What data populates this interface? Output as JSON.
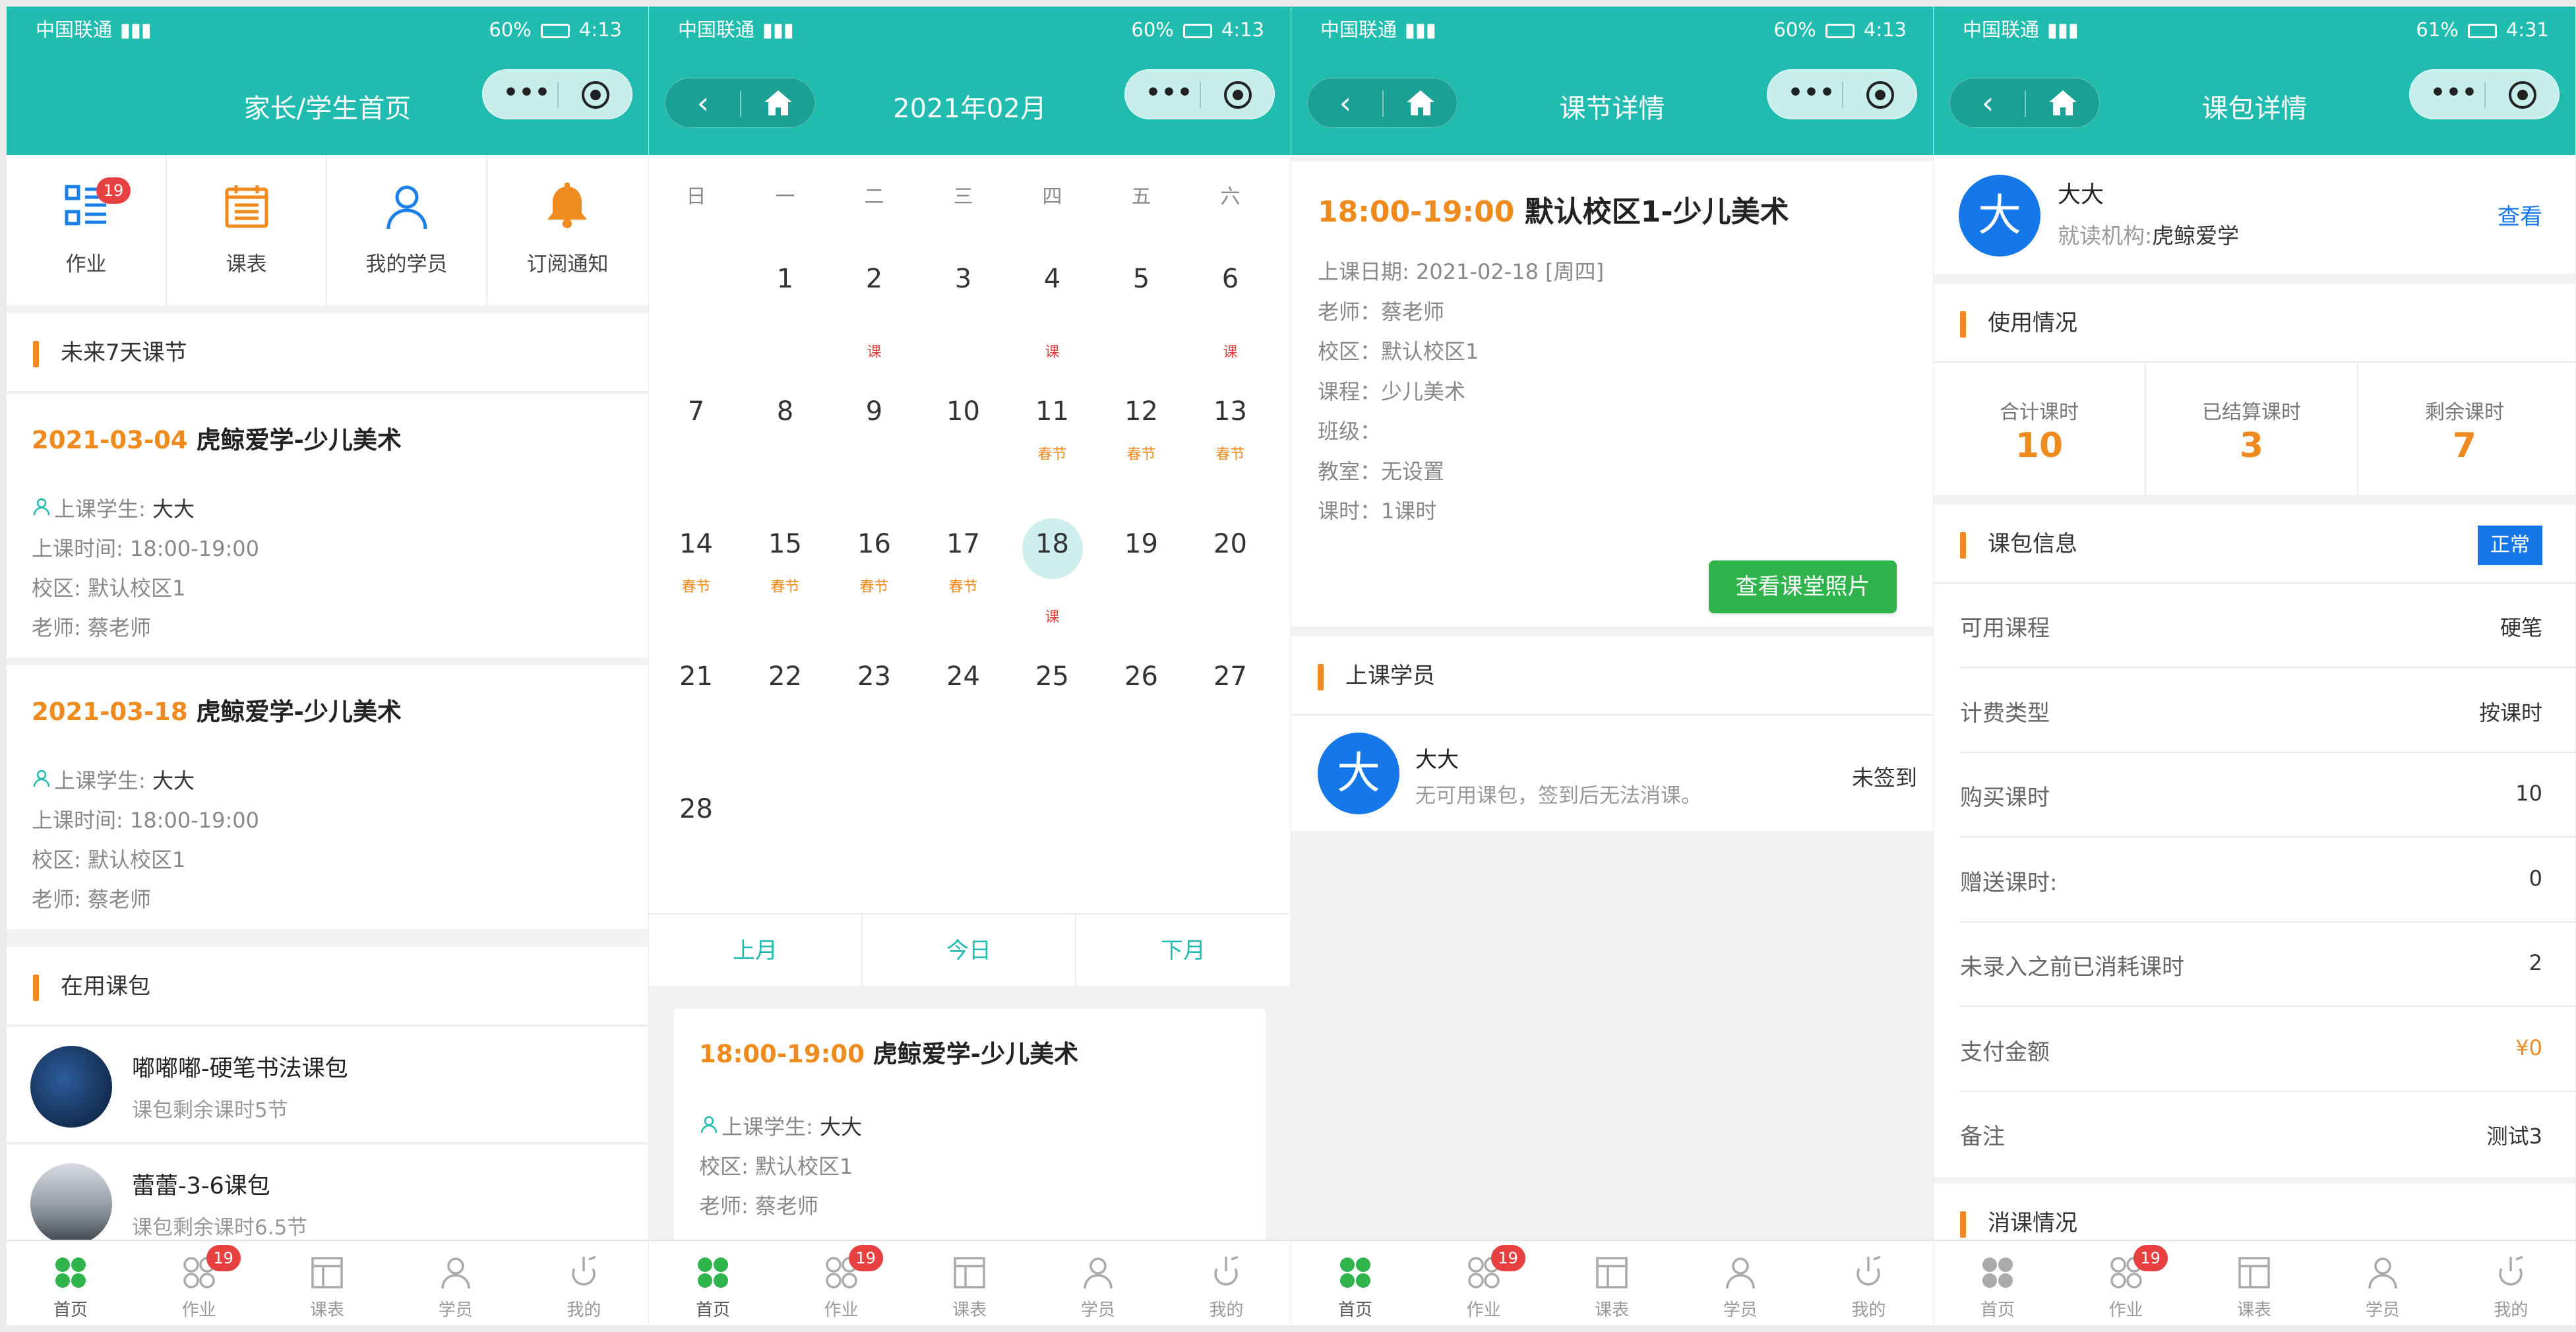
{
  "status_bar": {
    "carrier": "中国联通",
    "panels": [
      {
        "battery": "60%",
        "time": "4:13"
      },
      {
        "battery": "60%",
        "time": "4:13"
      },
      {
        "battery": "60%",
        "time": "4:13"
      },
      {
        "battery": "61%",
        "time": "4:31"
      }
    ]
  },
  "capsule": {
    "more": "•••"
  },
  "tabbar": {
    "items": [
      {
        "label": "首页",
        "icon": "home-icon"
      },
      {
        "label": "作业",
        "icon": "homework-icon",
        "badge": "19"
      },
      {
        "label": "课表",
        "icon": "schedule-icon"
      },
      {
        "label": "学员",
        "icon": "student-icon"
      },
      {
        "label": "我的",
        "icon": "profile-icon"
      }
    ]
  },
  "home": {
    "title": "家长/学生首页",
    "quick": [
      {
        "label": "作业",
        "icon": "homework-list-icon",
        "badge": "19",
        "color": "#1a7fe6"
      },
      {
        "label": "课表",
        "icon": "calendar-icon",
        "color": "#ef8a1f"
      },
      {
        "label": "我的学员",
        "icon": "user-icon",
        "color": "#1a7fe6"
      },
      {
        "label": "订阅通知",
        "icon": "bell-icon",
        "color": "#ef8a1f"
      }
    ],
    "upcoming_title": "未来7天课节",
    "lessons": [
      {
        "date": "2021-03-04",
        "name": "虎鲸爱学-少儿美术",
        "student_label": "上课学生:",
        "student": "大大",
        "time": "上课时间: 18:00-19:00",
        "campus": "校区: 默认校区1",
        "teacher": "老师: 蔡老师"
      },
      {
        "date": "2021-03-18",
        "name": "虎鲸爱学-少儿美术",
        "student_label": "上课学生:",
        "student": "大大",
        "time": "上课时间: 18:00-19:00",
        "campus": "校区: 默认校区1",
        "teacher": "老师: 蔡老师"
      }
    ],
    "packages_title": "在用课包",
    "packages": [
      {
        "name": "嘟嘟嘟-硬笔书法课包",
        "remain": "课包剩余课时5节"
      },
      {
        "name": "蕾蕾-3-6课包",
        "remain": "课包剩余课时6.5节"
      }
    ]
  },
  "calendar": {
    "title": "2021年02月",
    "weekdays": [
      "日",
      "一",
      "二",
      "三",
      "四",
      "五",
      "六"
    ],
    "rows": [
      [
        {
          "d": ""
        },
        {
          "d": "1"
        },
        {
          "d": "2",
          "mark": "课"
        },
        {
          "d": "3"
        },
        {
          "d": "4",
          "mark": "课"
        },
        {
          "d": "5"
        },
        {
          "d": "6",
          "mark": "课"
        }
      ],
      [
        {
          "d": "7"
        },
        {
          "d": "8"
        },
        {
          "d": "9"
        },
        {
          "d": "10"
        },
        {
          "d": "11",
          "hol": "春节"
        },
        {
          "d": "12",
          "hol": "春节"
        },
        {
          "d": "13",
          "hol": "春节"
        }
      ],
      [
        {
          "d": "14",
          "hol": "春节"
        },
        {
          "d": "15",
          "hol": "春节"
        },
        {
          "d": "16",
          "hol": "春节"
        },
        {
          "d": "17",
          "hol": "春节"
        },
        {
          "d": "18",
          "mark": "课",
          "today": true
        },
        {
          "d": "19"
        },
        {
          "d": "20"
        }
      ],
      [
        {
          "d": "21"
        },
        {
          "d": "22"
        },
        {
          "d": "23"
        },
        {
          "d": "24"
        },
        {
          "d": "25"
        },
        {
          "d": "26"
        },
        {
          "d": "27"
        }
      ],
      [
        {
          "d": "28"
        },
        {
          "d": ""
        },
        {
          "d": ""
        },
        {
          "d": ""
        },
        {
          "d": ""
        },
        {
          "d": ""
        },
        {
          "d": ""
        }
      ]
    ],
    "prev": "上月",
    "today": "今日",
    "next": "下月",
    "lesson": {
      "time": "18:00-19:00",
      "name": "虎鲸爱学-少儿美术",
      "student_label": "上课学生:",
      "student": "大大",
      "campus": "校区: 默认校区1",
      "teacher": "老师: 蔡老师"
    }
  },
  "lesson_detail": {
    "title": "课节详情",
    "time": "18:00-19:00",
    "name": "默认校区1-少儿美术",
    "lines": [
      "上课日期: 2021-02-18 [周四]",
      "老师：蔡老师",
      "校区：默认校区1",
      "课程：少儿美术",
      "班级：",
      "教室：无设置",
      "课时：1课时"
    ],
    "photo_button": "查看课堂照片",
    "students_title": "上课学员",
    "student": {
      "avatar": "大",
      "name": "大大",
      "note": "无可用课包，签到后无法消课。",
      "status": "未签到"
    }
  },
  "package_detail": {
    "title": "课包详情",
    "student": {
      "avatar": "大",
      "name": "大大",
      "org_label": "就读机构:",
      "org": "虎鲸爱学",
      "view": "查看"
    },
    "usage_title": "使用情况",
    "usage": [
      {
        "label": "合计课时",
        "value": "10"
      },
      {
        "label": "已结算课时",
        "value": "3"
      },
      {
        "label": "剩余课时",
        "value": "7"
      }
    ],
    "info_title": "课包信息",
    "status": "正常",
    "info": [
      {
        "k": "可用课程",
        "v": "硬笔"
      },
      {
        "k": "计费类型",
        "v": "按课时"
      },
      {
        "k": "购买课时",
        "v": "10"
      },
      {
        "k": "赠送课时:",
        "v": "0"
      },
      {
        "k": "未录入之前已消耗课时",
        "v": "2"
      },
      {
        "k": "支付金额",
        "v": "¥0"
      },
      {
        "k": "备注",
        "v": "测试3"
      }
    ],
    "consume_title": "消课情况"
  },
  "colors": {
    "teal": "#20bcb0",
    "orange": "#ef8a1f",
    "blue": "#1577e8",
    "green": "#2fb34b",
    "red": "#e74040"
  }
}
